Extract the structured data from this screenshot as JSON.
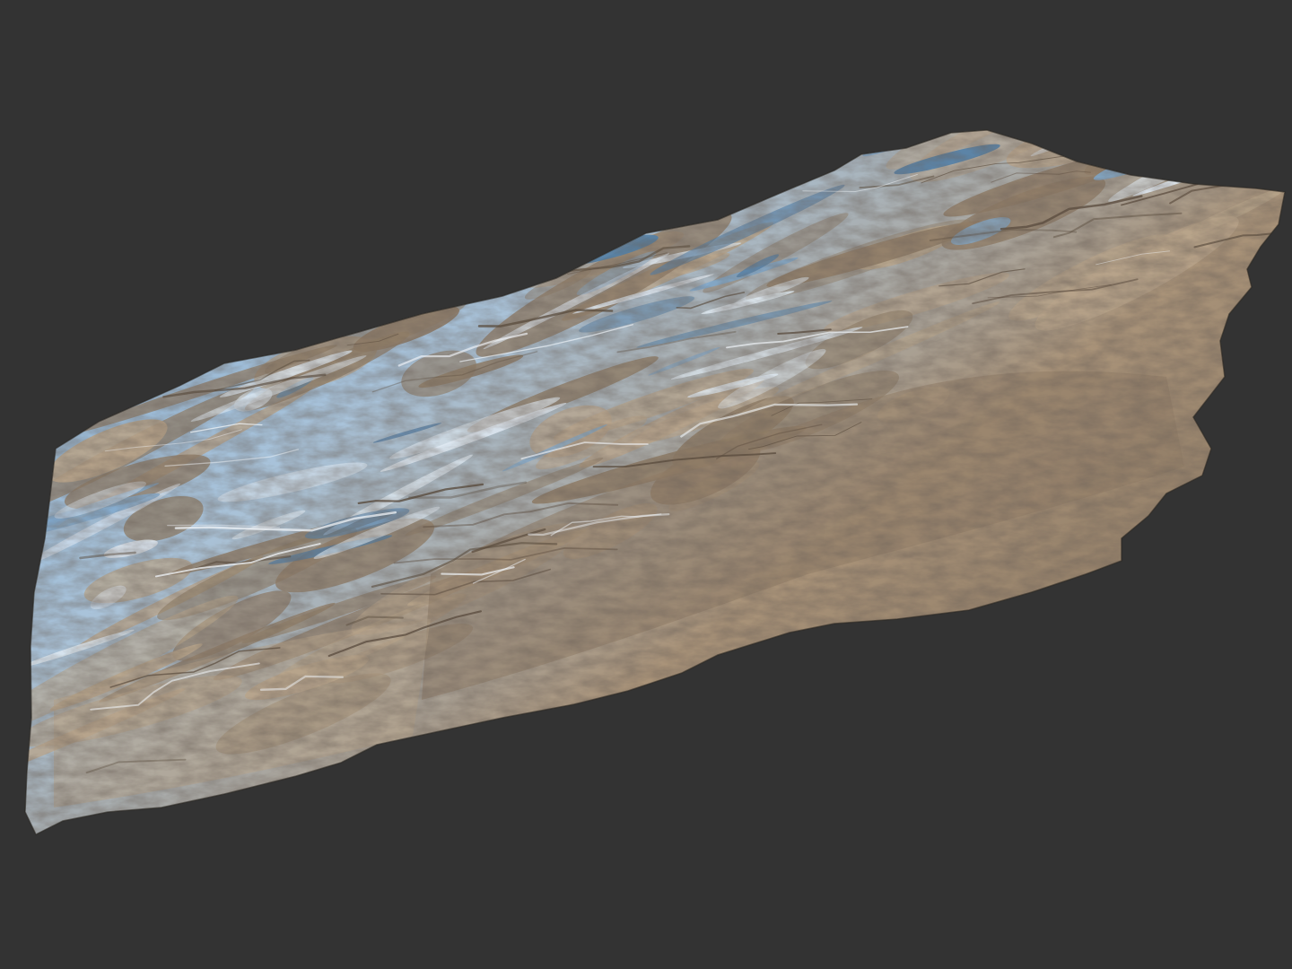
{
  "viewport": {
    "background_color": "#333333"
  },
  "terrain": {
    "subject": "terrain-mesh",
    "palette": {
      "snow_blue": "#7fa8cc",
      "snow_light": "#dfe9f2",
      "ice_blue": "#4f7ea8",
      "rock_tan": "#b8a48a",
      "rock_dark": "#5a4c3e",
      "rock_mid": "#8f7c66"
    }
  }
}
